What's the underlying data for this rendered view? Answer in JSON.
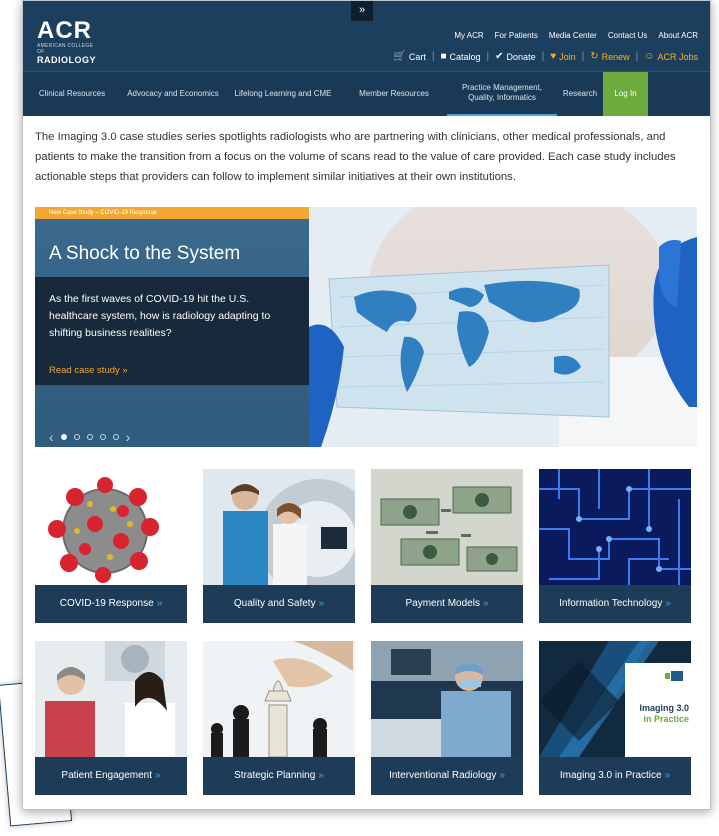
{
  "header": {
    "logo": {
      "acr": "ACR",
      "sub": "AMERICAN COLLEGE OF",
      "rad": "RADIOLOGY"
    },
    "toggle_icon": "chevron-double-down",
    "top_links": [
      "My ACR",
      "For Patients",
      "Media Center",
      "Contact Us",
      "About ACR"
    ],
    "utility_links": [
      {
        "label": "Cart",
        "icon": "cart-icon"
      },
      {
        "label": "Catalog",
        "icon": "book-icon"
      },
      {
        "label": "Donate",
        "icon": "check-icon"
      },
      {
        "label": "Join",
        "icon": "heart-icon"
      },
      {
        "label": "Renew",
        "icon": "refresh-icon"
      },
      {
        "label": "ACR Jobs",
        "icon": "people-icon"
      }
    ]
  },
  "nav": {
    "items": [
      {
        "label": "Clinical Resources"
      },
      {
        "label": "Advocacy and Economics"
      },
      {
        "label": "Lifelong Learning and CME"
      },
      {
        "label": "Member Resources"
      },
      {
        "label": "Practice Management, Quality, Informatics"
      },
      {
        "label": "Research"
      },
      {
        "label": "Log In"
      }
    ]
  },
  "intro": "The Imaging 3.0 case studies series spotlights radiologists who are partnering with clinicians, other medical professionals, and patients to make the transition from a focus on the volume of scans read to the value of care provided. Each case study includes actionable steps that providers can follow to implement similar initiatives at their own institutions.",
  "hero": {
    "tag": "New Case Study – COVID-19 Response",
    "title": "A Shock to the System",
    "description": "As the first waves of COVID-19 hit the U.S. healthcare system, how is radiology adapting to shifting business realities?",
    "cta": "Read case study »",
    "carousel": {
      "slides": 5,
      "active": 1
    }
  },
  "tiles": [
    {
      "label": "COVID-19 Response"
    },
    {
      "label": "Quality and Safety"
    },
    {
      "label": "Payment Models"
    },
    {
      "label": "Information Technology"
    },
    {
      "label": "Patient Engagement"
    },
    {
      "label": "Strategic Planning"
    },
    {
      "label": "Interventional Radiology"
    },
    {
      "label": "Imaging 3.0 in Practice"
    }
  ],
  "imaging_badge": {
    "line1": "Imaging 3.0",
    "line2": "in Practice"
  },
  "colors": {
    "header_bg": "#1d3f5e",
    "accent_orange": "#f2a72f",
    "login_green": "#6dab3c",
    "tile_label_bg": "#1e3b57"
  }
}
